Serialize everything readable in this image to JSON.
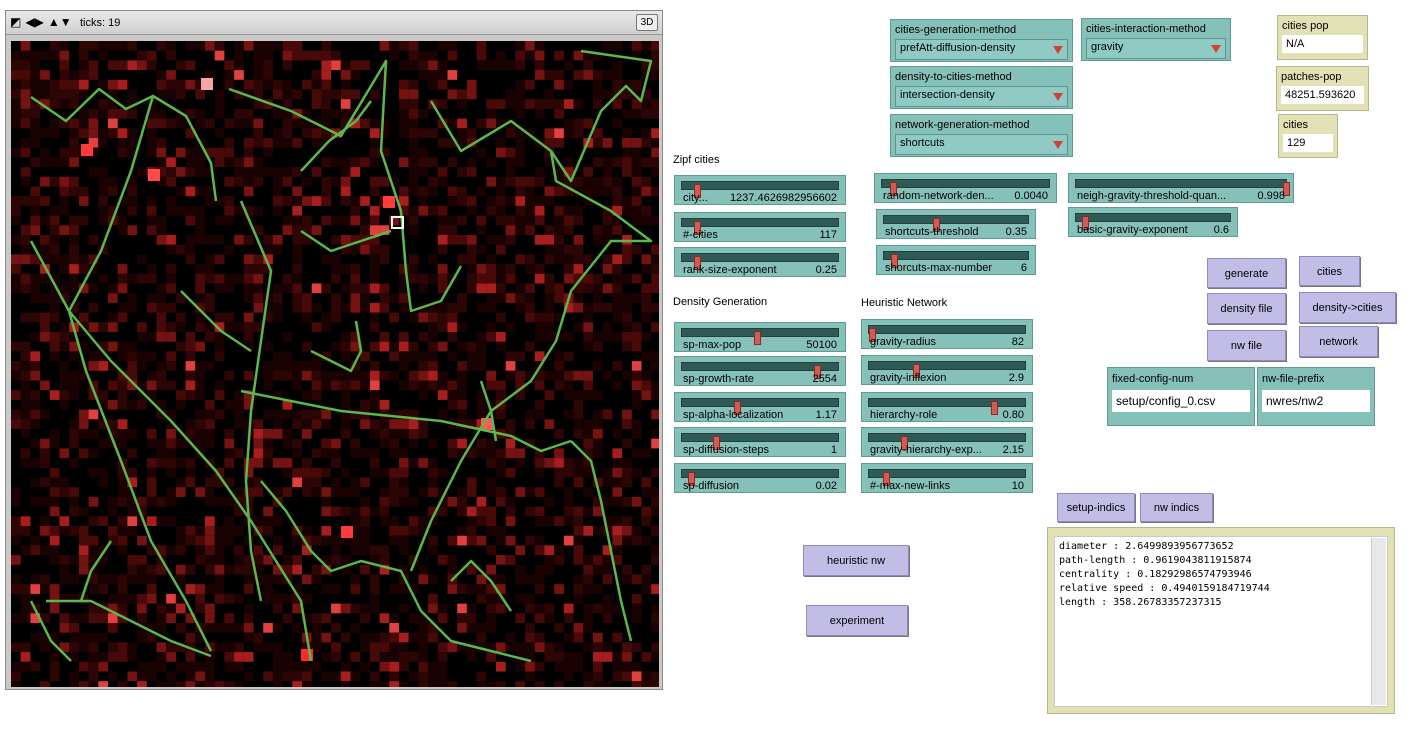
{
  "view": {
    "ticks_label": "ticks: 19",
    "three_d_label": "3D",
    "controls": [
      "edit-icon",
      "speed-arrows-icon",
      "updown-arrows-icon"
    ]
  },
  "choosers": {
    "cities_generation_method": {
      "label": "cities-generation-method",
      "value": "prefAtt-diffusion-density"
    },
    "cities_interaction_method": {
      "label": "cities-interaction-method",
      "value": "gravity"
    },
    "density_to_cities_method": {
      "label": "density-to-cities-method",
      "value": "intersection-density"
    },
    "network_generation_method": {
      "label": "network-generation-method",
      "value": "shortcuts"
    }
  },
  "monitors": {
    "cities_pop": {
      "label": "cities pop",
      "value": "N/A"
    },
    "patches_pop": {
      "label": "patches-pop",
      "value": "48251.593620"
    },
    "cities": {
      "label": "cities",
      "value": "129"
    }
  },
  "notes": {
    "zipf_cities": "Zipf cities",
    "density_generation": "Density Generation",
    "heuristic_network": "Heuristic Network"
  },
  "sliders": {
    "city_max_pop": {
      "name": "city...",
      "value": "1237.4626982956602",
      "fraction": 0.08
    },
    "num_cities": {
      "name": "#-cities",
      "value": "117",
      "fraction": 0.08
    },
    "rank_size_exponent": {
      "name": "rank-size-exponent",
      "value": "0.25",
      "fraction": 0.08
    },
    "random_network_density": {
      "name": "random-network-den...",
      "value": "0.0040",
      "fraction": 0.05
    },
    "shortcuts_threshold": {
      "name": "shortcuts-threshold",
      "value": "0.35",
      "fraction": 0.35
    },
    "shortcuts_max_number": {
      "name": "shorcuts-max-number",
      "value": "6",
      "fraction": 0.05
    },
    "neigh_gravity_threshold_quantile": {
      "name": "neigh-gravity-threshold-quan...",
      "value": "0.998",
      "fraction": 1.0
    },
    "basic_gravity_exponent": {
      "name": "basic-gravity-exponent",
      "value": "0.6",
      "fraction": 0.04
    },
    "sp_max_pop": {
      "name": "sp-max-pop",
      "value": "50100",
      "fraction": 0.47
    },
    "sp_growth_rate": {
      "name": "sp-growth-rate",
      "value": "2554",
      "fraction": 0.86
    },
    "sp_alpha_localization": {
      "name": "sp-alpha-localization",
      "value": "1.17",
      "fraction": 0.34
    },
    "sp_diffusion_steps": {
      "name": "sp-diffusion-steps",
      "value": "1",
      "fraction": 0.2
    },
    "sp_diffusion": {
      "name": "sp-diffusion",
      "value": "0.02",
      "fraction": 0.04
    },
    "gravity_radius": {
      "name": "gravity-radius",
      "value": "82",
      "fraction": 0.0
    },
    "gravity_inflexion": {
      "name": "gravity-inflexion",
      "value": "2.9",
      "fraction": 0.29
    },
    "hierarchy_role": {
      "name": "hierarchy-role",
      "value": "0.80",
      "fraction": 0.8
    },
    "gravity_hierarchy_exponent": {
      "name": "gravity-hierarchy-exp...",
      "value": "2.15",
      "fraction": 0.21
    },
    "max_new_links": {
      "name": "#-max-new-links",
      "value": "10",
      "fraction": 0.09
    }
  },
  "buttons": {
    "generate": "generate",
    "cities": "cities",
    "density_file": "density file",
    "density_to_cities": "density->cities",
    "nw_file": "nw file",
    "network": "network",
    "setup_indics": "setup-indics",
    "nw_indics": "nw indics",
    "heuristic_nw": "heuristic nw",
    "experiment": "experiment"
  },
  "inputs": {
    "fixed_config_num": {
      "label": "fixed-config-num",
      "value": "setup/config_0.csv"
    },
    "nw_file_prefix": {
      "label": "nw-file-prefix",
      "value": "nwres/nw2"
    }
  },
  "output": {
    "lines": [
      "diameter : 2.6499893956773652",
      "path-length : 0.9619043811915874",
      "centrality : 0.18292986574793946",
      "relative speed : 0.4940159184719744",
      "length : 358.26783357237315"
    ]
  },
  "colors": {
    "widget_teal": "#86c1b9",
    "button_lavender": "#c1bde6",
    "monitor_khaki": "#e2e0b5",
    "network_green": "#5cb84a",
    "density_red": "#d03030"
  }
}
